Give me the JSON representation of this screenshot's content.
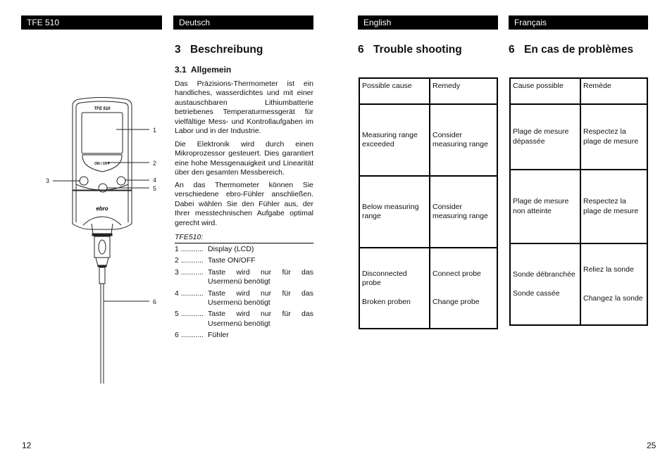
{
  "left_page": {
    "header_bar_model": "TFE 510",
    "header_bar_lang": "Deutsch",
    "section_number": "3",
    "section_title": "Beschreibung",
    "subsection": "3.1  Allgemein",
    "paragraphs": [
      "Das Präzisions-Thermometer ist ein handliches, wasserdichtes und mit einer austauschbaren Lithiumbatterie betriebenes Temperaturmessgerät für vielfältige Mess- und Kontrollaufgaben im Labor und in der Industrie.",
      "Die Elektronik wird durch einen Mikroprozessor gesteuert. Dies garantiert eine hohe Messgenauigkeit und Linearität über den gesamten Messbereich.",
      "An das Thermometer können Sie verschiedene ebro-Fühler anschließen. Dabei wählen Sie den Fühler aus, der Ihrer messtechnischen Aufgabe optimal gerecht wird."
    ],
    "parts_label": "TFE510:",
    "parts": [
      {
        "key": "1 ...........",
        "value": "Display (LCD)"
      },
      {
        "key": "2 ...........",
        "value": "Taste ON/OFF"
      },
      {
        "key": "3 ...........",
        "value": "Taste wird nur für das Usermenü benötigt"
      },
      {
        "key": "4 ...........",
        "value": "Taste wird nur für das Usermenü benötigt"
      },
      {
        "key": "5 ...........",
        "value": "Taste wird nur für das Usermenü benötigt"
      },
      {
        "key": "6 ...........",
        "value": "Fühler"
      }
    ],
    "device": {
      "model_label": "TFE 510",
      "button_label": "ON / OFF",
      "brand": "ebro",
      "callouts": [
        "1",
        "2",
        "3",
        "4",
        "5",
        "6"
      ]
    },
    "page_number": "12"
  },
  "right_page": {
    "english": {
      "header_bar_lang": "English",
      "section_number": "6",
      "section_title": "Trouble shooting",
      "table": {
        "headers": [
          "Possible cause",
          "Remedy"
        ],
        "rows": [
          {
            "cause": [
              "Measuring range exceeded"
            ],
            "remedy": [
              "Consider measuring range"
            ]
          },
          {
            "cause": [
              "Below measuring range"
            ],
            "remedy": [
              "Consider measuring range"
            ]
          },
          {
            "cause": [
              "Disconnected probe",
              "Broken proben"
            ],
            "remedy": [
              "Connect probe",
              "Change probe"
            ]
          }
        ]
      }
    },
    "french": {
      "header_bar_lang": "Français",
      "section_number": "6",
      "section_title": "En cas de problèmes",
      "table": {
        "headers": [
          "Cause possible",
          "Remède"
        ],
        "rows": [
          {
            "cause": [
              "Plage de mesure dépassée"
            ],
            "remedy": [
              "Respectez la plage de mesure"
            ]
          },
          {
            "cause": [
              "Plage de mesure non atteinte"
            ],
            "remedy": [
              "Respectez la plage de mesure"
            ]
          },
          {
            "cause": [
              "Sonde débranchée",
              "Sonde cassée"
            ],
            "remedy": [
              "Reliez la sonde",
              "Changez la sonde"
            ]
          }
        ]
      }
    },
    "page_number": "25"
  }
}
